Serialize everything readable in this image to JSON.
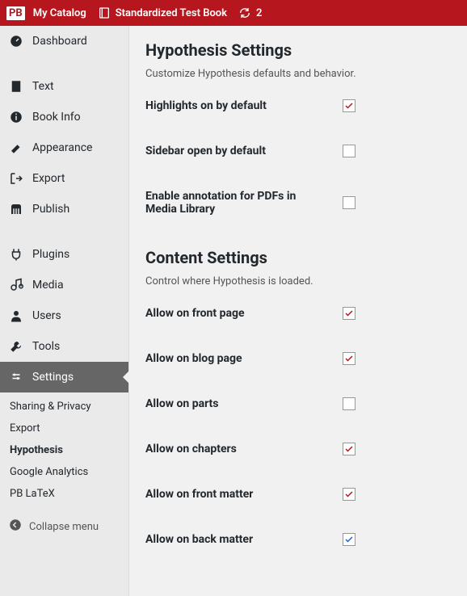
{
  "adminbar": {
    "logo": "PB",
    "catalog": "My Catalog",
    "book": "Standardized Test Book",
    "refresh_count": "2"
  },
  "sidebar": {
    "items": [
      {
        "label": "Dashboard"
      },
      {
        "label": "Text"
      },
      {
        "label": "Book Info"
      },
      {
        "label": "Appearance"
      },
      {
        "label": "Export"
      },
      {
        "label": "Publish"
      },
      {
        "label": "Plugins"
      },
      {
        "label": "Media"
      },
      {
        "label": "Users"
      },
      {
        "label": "Tools"
      },
      {
        "label": "Settings"
      }
    ],
    "submenu": [
      "Sharing & Privacy",
      "Export",
      "Hypothesis",
      "Google Analytics",
      "PB LaTeX"
    ],
    "collapse": "Collapse menu"
  },
  "content": {
    "hypothesis": {
      "heading": "Hypothesis Settings",
      "desc": "Customize Hypothesis defaults and behavior.",
      "rows": [
        {
          "label": "Highlights on by default",
          "checked": true
        },
        {
          "label": "Sidebar open by default",
          "checked": false
        },
        {
          "label": "Enable annotation for PDFs in Media Library",
          "checked": false
        }
      ]
    },
    "contentSettings": {
      "heading": "Content Settings",
      "desc": "Control where Hypothesis is loaded.",
      "rows": [
        {
          "label": "Allow on front page",
          "checked": true
        },
        {
          "label": "Allow on blog page",
          "checked": true
        },
        {
          "label": "Allow on parts",
          "checked": false
        },
        {
          "label": "Allow on chapters",
          "checked": true
        },
        {
          "label": "Allow on front matter",
          "checked": true
        },
        {
          "label": "Allow on back matter",
          "checked": true,
          "blue": true
        }
      ]
    }
  }
}
